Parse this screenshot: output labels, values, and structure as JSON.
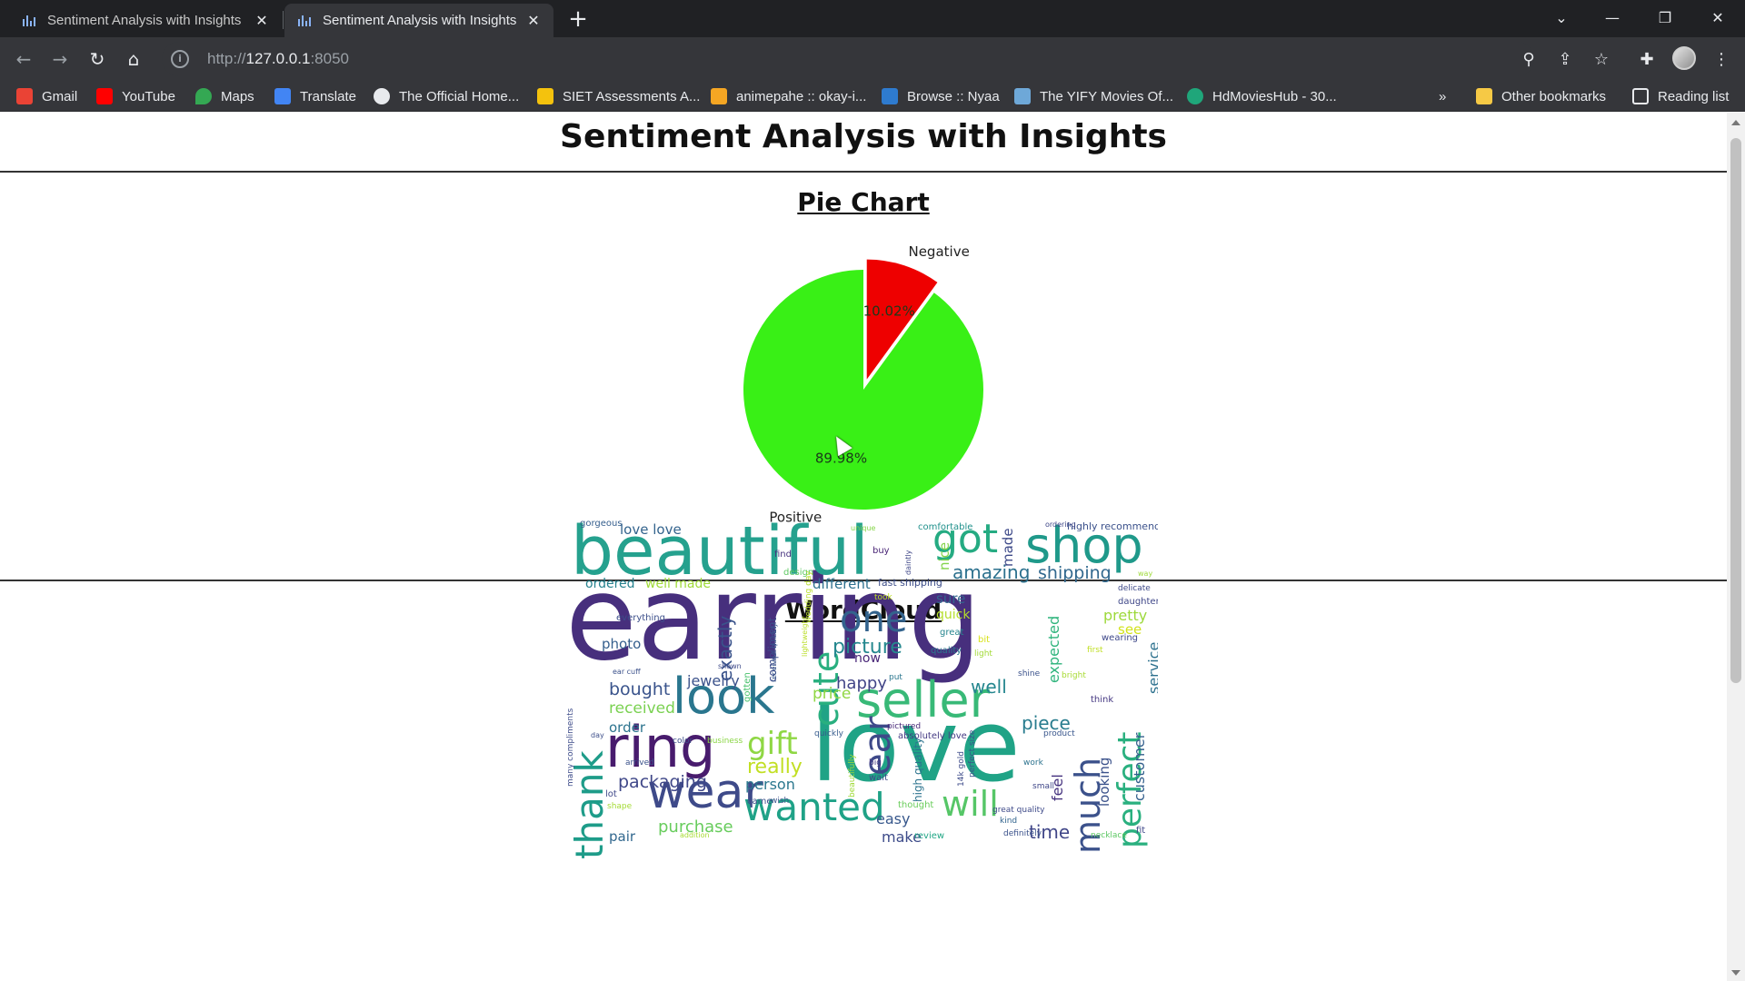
{
  "browser": {
    "tabs": [
      {
        "title": "Sentiment Analysis with Insights",
        "active": false
      },
      {
        "title": "Sentiment Analysis with Insights",
        "active": true
      }
    ],
    "url_scheme": "http://",
    "url_host": "127.0.0.1",
    "url_port": ":8050",
    "bookmarks": [
      {
        "label": "Gmail",
        "icon": "gmail-icon",
        "color": "#ea4335"
      },
      {
        "label": "YouTube",
        "icon": "youtube-icon",
        "color": "#ff0000"
      },
      {
        "label": "Maps",
        "icon": "maps-icon",
        "color": "#34a853"
      },
      {
        "label": "Translate",
        "icon": "translate-icon",
        "color": "#4285f4"
      },
      {
        "label": "The Official Home...",
        "icon": "globe-icon",
        "color": "#e8eaed"
      },
      {
        "label": "SIET Assessments A...",
        "icon": "siet-icon",
        "color": "#f4c20d"
      },
      {
        "label": "animepahe :: okay-i...",
        "icon": "animepahe-icon",
        "color": "#f5a623"
      },
      {
        "label": "Browse :: Nyaa",
        "icon": "nyaa-icon",
        "color": "#2e7bcf"
      },
      {
        "label": "The YIFY Movies Of...",
        "icon": "yify-icon",
        "color": "#6ea8d8"
      },
      {
        "label": "HdMoviesHub - 30...",
        "icon": "hdmovieshub-icon",
        "color": "#1fa67a"
      }
    ],
    "other_bookmarks": "Other bookmarks",
    "reading_list": "Reading list"
  },
  "page": {
    "title": "Sentiment Analysis with Insights",
    "pie_section_title": "Pie Chart",
    "wordcloud_section_title": "WordCloud"
  },
  "chart_data": {
    "type": "pie",
    "title": "",
    "slices": [
      {
        "label": "Positive",
        "value": 89.98,
        "pct_label": "89.98%",
        "color": "#39f016"
      },
      {
        "label": "Negative",
        "value": 10.02,
        "pct_label": "10.02%",
        "color": "#ee0000"
      }
    ],
    "exploded": "Negative",
    "start_angle_deg": 90
  },
  "wordcloud": {
    "words": [
      {
        "text": "earring",
        "color": "#472f7d"
      },
      {
        "text": "beautiful",
        "color": "#25a18e"
      },
      {
        "text": "love",
        "color": "#20a386"
      },
      {
        "text": "shop",
        "color": "#1f998a"
      },
      {
        "text": "got",
        "color": "#25ab82"
      },
      {
        "text": "seller",
        "color": "#38b977"
      },
      {
        "text": "look",
        "color": "#2a768e"
      },
      {
        "text": "ring",
        "color": "#481b6d"
      },
      {
        "text": "wear",
        "color": "#3e4a89"
      },
      {
        "text": "wanted",
        "color": "#1fa287"
      },
      {
        "text": "will",
        "color": "#56c667"
      },
      {
        "text": "one",
        "color": "#33638d"
      },
      {
        "text": "cute",
        "color": "#29af7f"
      },
      {
        "text": "thank",
        "color": "#1e9c89"
      },
      {
        "text": "much",
        "color": "#3b518b"
      },
      {
        "text": "perfect",
        "color": "#2ab07f"
      },
      {
        "text": "ear",
        "color": "#3e4989"
      },
      {
        "text": "gift",
        "color": "#8fd744"
      },
      {
        "text": "picture",
        "color": "#24878e"
      },
      {
        "text": "amazing",
        "color": "#2c718e"
      },
      {
        "text": "shipping",
        "color": "#31688e"
      },
      {
        "text": "packaging",
        "color": "#3f4788"
      },
      {
        "text": "really",
        "color": "#c2df23"
      },
      {
        "text": "purchase",
        "color": "#67cc5c"
      },
      {
        "text": "time",
        "color": "#404688"
      },
      {
        "text": "piece",
        "color": "#287c8e"
      },
      {
        "text": "well",
        "color": "#24868e"
      },
      {
        "text": "bought",
        "color": "#3a548c"
      },
      {
        "text": "received",
        "color": "#7ad151"
      },
      {
        "text": "happy",
        "color": "#414487"
      },
      {
        "text": "price",
        "color": "#90d743"
      },
      {
        "text": "jewelry",
        "color": "#3b528b"
      },
      {
        "text": "exactly",
        "color": "#3a538b"
      },
      {
        "text": "photo",
        "color": "#355f8d"
      },
      {
        "text": "ordered",
        "color": "#26828e"
      },
      {
        "text": "well made",
        "color": "#a0da39"
      },
      {
        "text": "different",
        "color": "#2d708e"
      },
      {
        "text": "pretty",
        "color": "#9dd93b"
      },
      {
        "text": "see",
        "color": "#d2e21b"
      },
      {
        "text": "sure",
        "color": "#32658e"
      },
      {
        "text": "quick",
        "color": "#b5de2b"
      },
      {
        "text": "expected",
        "color": "#2fb47c"
      },
      {
        "text": "made",
        "color": "#3e4a89"
      },
      {
        "text": "nice",
        "color": "#84d44b"
      },
      {
        "text": "service",
        "color": "#2d718e"
      },
      {
        "text": "customer",
        "color": "#34608d"
      },
      {
        "text": "looking",
        "color": "#3b528b"
      },
      {
        "text": "feel",
        "color": "#46337f"
      },
      {
        "text": "easy",
        "color": "#38588c"
      },
      {
        "text": "make",
        "color": "#3e4c8a"
      },
      {
        "text": "pair",
        "color": "#31678e"
      },
      {
        "text": "order",
        "color": "#2c738e"
      },
      {
        "text": "person",
        "color": "#2a778e"
      },
      {
        "text": "now",
        "color": "#482677"
      },
      {
        "text": "love love",
        "color": "#33638d"
      },
      {
        "text": "compliment",
        "color": "#3e4c8a"
      },
      {
        "text": "highly recommend",
        "color": "#3b518b"
      },
      {
        "text": "fast shipping",
        "color": "#3d4e8a"
      },
      {
        "text": "absolutely love",
        "color": "#443a83"
      },
      {
        "text": "gorgeous",
        "color": "#355e8d"
      },
      {
        "text": "comfortable",
        "color": "#21918c"
      },
      {
        "text": "everything",
        "color": "#3c4f8a"
      },
      {
        "text": "quality",
        "color": "#2a788e"
      },
      {
        "text": "great",
        "color": "#25858e"
      },
      {
        "text": "wearing",
        "color": "#3f4889"
      },
      {
        "text": "daughter",
        "color": "#3f4788"
      },
      {
        "text": "delicate",
        "color": "#3e4a89"
      },
      {
        "text": "think",
        "color": "#453882"
      },
      {
        "text": "buy",
        "color": "#482475"
      },
      {
        "text": "find",
        "color": "#46327e"
      },
      {
        "text": "design",
        "color": "#5ec962"
      },
      {
        "text": "took",
        "color": "#bddf26"
      },
      {
        "text": "bit",
        "color": "#d8e219"
      },
      {
        "text": "light",
        "color": "#a2da37"
      },
      {
        "text": "shine",
        "color": "#3b528b"
      },
      {
        "text": "bright",
        "color": "#a8db34"
      },
      {
        "text": "first",
        "color": "#c0df25"
      },
      {
        "text": "quickly",
        "color": "#365c8d"
      },
      {
        "text": "product",
        "color": "#39568c"
      },
      {
        "text": "big",
        "color": "#453781"
      },
      {
        "text": "wait",
        "color": "#3e4989"
      },
      {
        "text": "small",
        "color": "#3f4788"
      },
      {
        "text": "work",
        "color": "#2c728e"
      },
      {
        "text": "great quality",
        "color": "#3e4a89"
      },
      {
        "text": "kind",
        "color": "#32648e"
      },
      {
        "text": "definitely",
        "color": "#3b528b"
      },
      {
        "text": "necklace",
        "color": "#5cc863"
      },
      {
        "text": "fit",
        "color": "#3f4889"
      },
      {
        "text": "review",
        "color": "#21a685"
      },
      {
        "text": "came",
        "color": "#3c508b"
      },
      {
        "text": "wish",
        "color": "#3a548c"
      },
      {
        "text": "thought",
        "color": "#69cd5b"
      },
      {
        "text": "arrived",
        "color": "#3b528b"
      },
      {
        "text": "lot",
        "color": "#3f4889"
      },
      {
        "text": "shape",
        "color": "#a5db36"
      },
      {
        "text": "color",
        "color": "#3c4f8a"
      },
      {
        "text": "business",
        "color": "#8bd646"
      },
      {
        "text": "day",
        "color": "#3d4e8a"
      },
      {
        "text": "addition",
        "color": "#a8db34"
      },
      {
        "text": "ear cuff",
        "color": "#3b518b"
      },
      {
        "text": "many compliments",
        "color": "#3e4c8a"
      },
      {
        "text": "wedding day",
        "color": "#b8de29"
      },
      {
        "text": "ordering",
        "color": "#3f4788"
      },
      {
        "text": "unique",
        "color": "#86d549"
      },
      {
        "text": "pictured",
        "color": "#482878"
      },
      {
        "text": "high quality",
        "color": "#2c738e"
      },
      {
        "text": "put",
        "color": "#2a768e"
      },
      {
        "text": "shown",
        "color": "#3e4a89"
      },
      {
        "text": "gotten",
        "color": "#4ac16d"
      },
      {
        "text": "way",
        "color": "#9fda3a"
      },
      {
        "text": "lightweight",
        "color": "#bade28"
      },
      {
        "text": "daintly",
        "color": "#3f4788"
      },
      {
        "text": "beautifully",
        "color": "#a0da39"
      },
      {
        "text": "perfect size",
        "color": "#3b528b"
      },
      {
        "text": "14k gold",
        "color": "#3e4c8a"
      },
      {
        "text": "received quickly",
        "color": "#38588c"
      }
    ]
  }
}
